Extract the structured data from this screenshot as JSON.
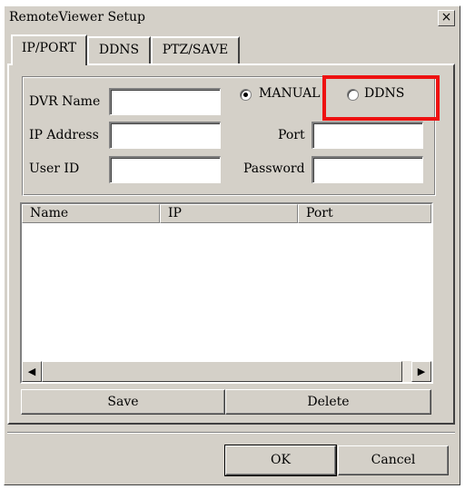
{
  "window": {
    "title": "RemoteViewer Setup",
    "close_glyph": "×"
  },
  "tabs": [
    {
      "label": "IP/PORT",
      "active": true
    },
    {
      "label": "DDNS",
      "active": false
    },
    {
      "label": "PTZ/SAVE",
      "active": false
    }
  ],
  "form": {
    "dvr_name_label": "DVR Name",
    "dvr_name_value": "",
    "ip_address_label": "IP Address",
    "ip_address_value": "",
    "user_id_label": "User ID",
    "user_id_value": "",
    "port_label": "Port",
    "port_value": "",
    "password_label": "Password",
    "password_value": "",
    "mode_manual_label": "MANUAL",
    "mode_ddns_label": "DDNS",
    "selected_mode": "MANUAL"
  },
  "list": {
    "columns": [
      "Name",
      "IP",
      "Port"
    ],
    "rows": []
  },
  "scrollbar": {
    "left_arrow": "◀",
    "right_arrow": "▶"
  },
  "actions": {
    "save_label": "Save",
    "delete_label": "Delete",
    "ok_label": "OK",
    "cancel_label": "Cancel"
  },
  "colors": {
    "dialog_bg": "#d4d0c8",
    "highlight": "#ee1111"
  }
}
